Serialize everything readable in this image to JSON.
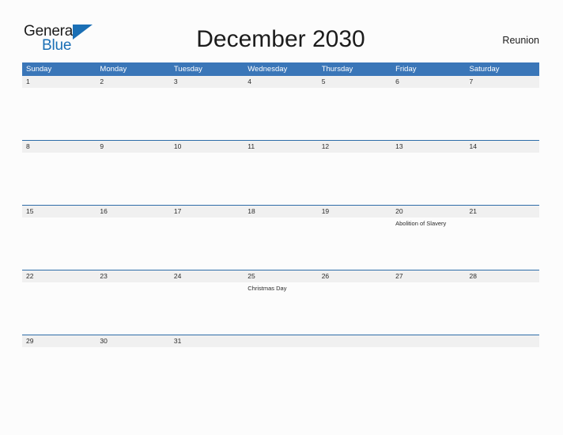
{
  "logo": {
    "word_one": "General",
    "word_two": "Blue",
    "flag_icon": "triangle-flag-icon",
    "brand_color": "#1a6fb5"
  },
  "header": {
    "title": "December 2030",
    "region": "Reunion"
  },
  "theme": {
    "header_blue": "#3a76b8",
    "rule_blue": "#2e6da8",
    "date_stripe": "#f0f0f0",
    "page_background": "#fcfcfc",
    "text_color": "#2b2b2b"
  },
  "calendar": {
    "weekdays": [
      "Sunday",
      "Monday",
      "Tuesday",
      "Wednesday",
      "Thursday",
      "Friday",
      "Saturday"
    ],
    "weeks": [
      {
        "days": [
          {
            "date": "1",
            "events": []
          },
          {
            "date": "2",
            "events": []
          },
          {
            "date": "3",
            "events": []
          },
          {
            "date": "4",
            "events": []
          },
          {
            "date": "5",
            "events": []
          },
          {
            "date": "6",
            "events": []
          },
          {
            "date": "7",
            "events": []
          }
        ]
      },
      {
        "days": [
          {
            "date": "8",
            "events": []
          },
          {
            "date": "9",
            "events": []
          },
          {
            "date": "10",
            "events": []
          },
          {
            "date": "11",
            "events": []
          },
          {
            "date": "12",
            "events": []
          },
          {
            "date": "13",
            "events": []
          },
          {
            "date": "14",
            "events": []
          }
        ]
      },
      {
        "days": [
          {
            "date": "15",
            "events": []
          },
          {
            "date": "16",
            "events": []
          },
          {
            "date": "17",
            "events": []
          },
          {
            "date": "18",
            "events": []
          },
          {
            "date": "19",
            "events": []
          },
          {
            "date": "20",
            "events": [
              "Abolition of Slavery"
            ]
          },
          {
            "date": "21",
            "events": []
          }
        ]
      },
      {
        "days": [
          {
            "date": "22",
            "events": []
          },
          {
            "date": "23",
            "events": []
          },
          {
            "date": "24",
            "events": []
          },
          {
            "date": "25",
            "events": [
              "Christmas Day"
            ]
          },
          {
            "date": "26",
            "events": []
          },
          {
            "date": "27",
            "events": []
          },
          {
            "date": "28",
            "events": []
          }
        ]
      },
      {
        "days": [
          {
            "date": "29",
            "events": []
          },
          {
            "date": "30",
            "events": []
          },
          {
            "date": "31",
            "events": []
          },
          {
            "date": "",
            "events": []
          },
          {
            "date": "",
            "events": []
          },
          {
            "date": "",
            "events": []
          },
          {
            "date": "",
            "events": []
          }
        ]
      }
    ]
  }
}
